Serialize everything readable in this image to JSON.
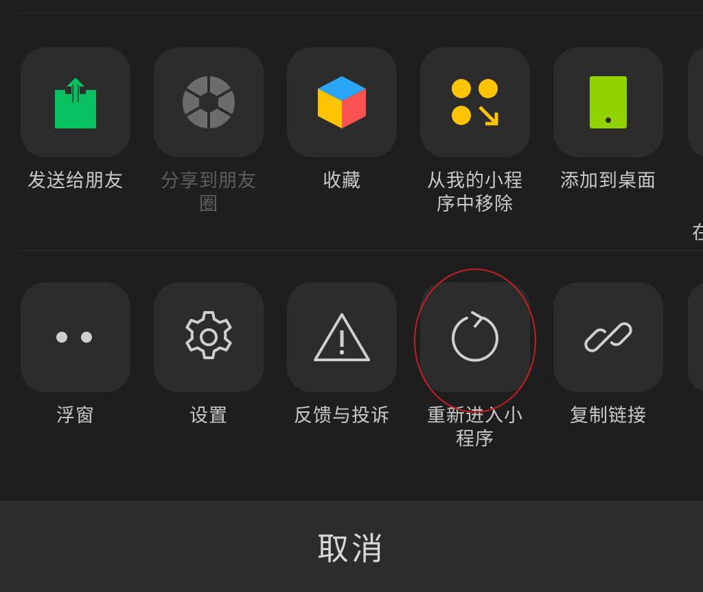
{
  "colors": {
    "background": "#1e1e1e",
    "tile": "#2c2c2c",
    "label": "#c9c9c9",
    "label_disabled": "#5e5e5e",
    "share_green": "#07c160",
    "desktop_green": "#91d300",
    "yellow": "#ffc300",
    "highlight_red": "#c81e23"
  },
  "row1": [
    {
      "label": "发送给朋友",
      "icon": "share-to-friend-icon",
      "disabled": false
    },
    {
      "label": "分享到朋友圈",
      "icon": "moments-shutter-icon",
      "disabled": true
    },
    {
      "label": "收藏",
      "icon": "favorites-cube-icon",
      "disabled": false
    },
    {
      "label": "从我的小程序中移除",
      "icon": "remove-mini-program-icon",
      "disabled": false
    },
    {
      "label": "添加到桌面",
      "icon": "add-to-desktop-icon",
      "disabled": false
    }
  ],
  "row1_partial_label": "在",
  "row2": [
    {
      "label": "浮窗",
      "icon": "floating-window-icon"
    },
    {
      "label": "设置",
      "icon": "gear-icon"
    },
    {
      "label": "反馈与投诉",
      "icon": "warning-icon"
    },
    {
      "label": "重新进入小程序",
      "icon": "refresh-icon"
    },
    {
      "label": "复制链接",
      "icon": "link-icon"
    }
  ],
  "cancel_label": "取消"
}
